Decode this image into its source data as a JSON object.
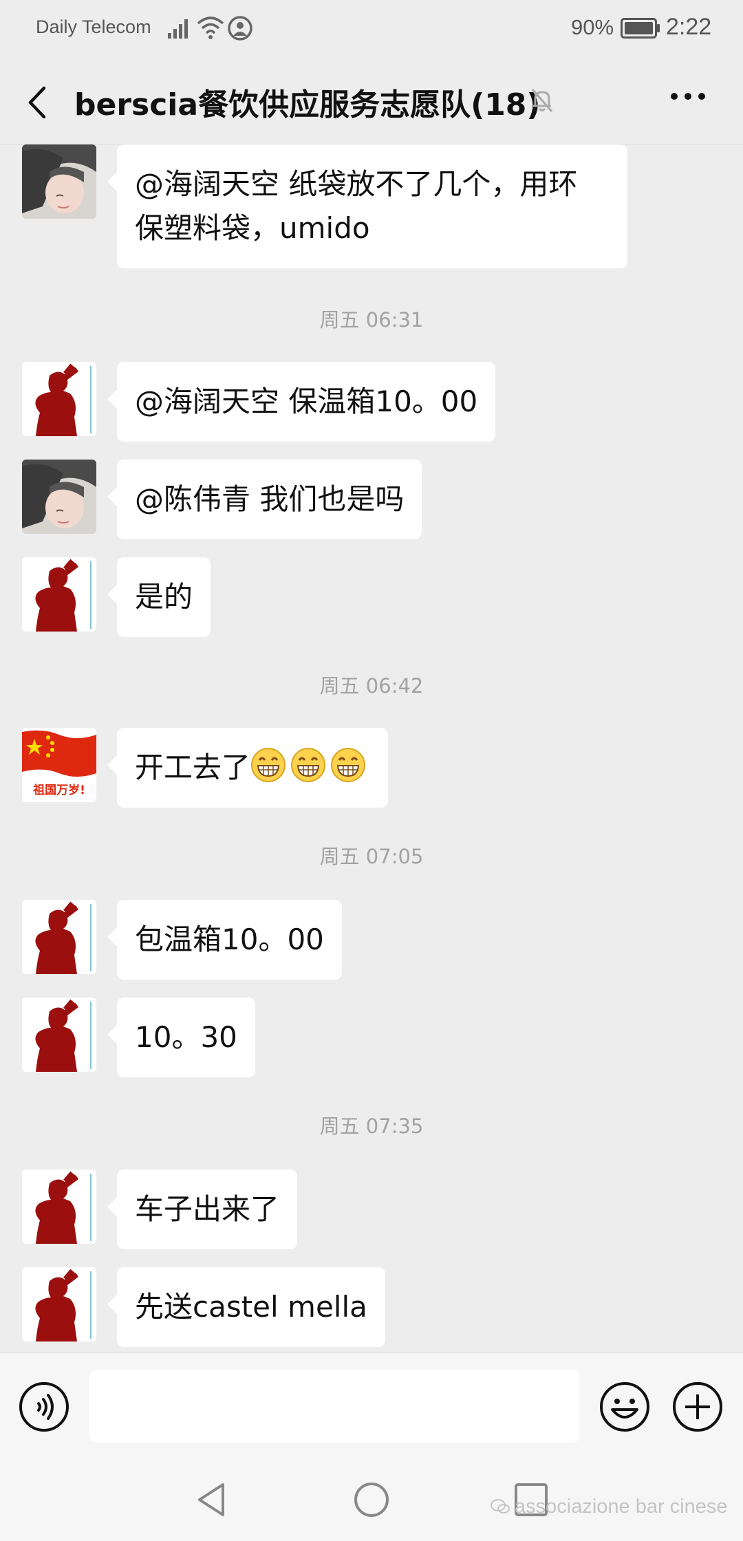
{
  "status_bar": {
    "carrier": "Daily Telecom",
    "battery": "90%",
    "time": "2:22"
  },
  "nav": {
    "title": "berscia餐饮供应服务志愿队(18)"
  },
  "messages": [
    {
      "type": "message",
      "avatar": "girl-photo",
      "lines": [
        "@海阔天空 纸袋放不了几个，用环",
        "保塑料袋，umido"
      ]
    },
    {
      "type": "timestamp",
      "text": "周五 06:31"
    },
    {
      "type": "message",
      "avatar": "silhouette",
      "text": "@海阔天空 保温箱10。00"
    },
    {
      "type": "message",
      "avatar": "girl-photo",
      "text": "@陈伟青 我们也是吗"
    },
    {
      "type": "message",
      "avatar": "silhouette",
      "text": "是的"
    },
    {
      "type": "timestamp",
      "text": "周五 06:42"
    },
    {
      "type": "message",
      "avatar": "flag",
      "avatar_text": "祖国万岁!",
      "text": "开工去了",
      "emoji_count": 3,
      "emoji": "grin-emoji"
    },
    {
      "type": "timestamp",
      "text": "周五 07:05"
    },
    {
      "type": "message",
      "avatar": "silhouette",
      "text": "包温箱10。00"
    },
    {
      "type": "message",
      "avatar": "silhouette",
      "text": "10。30"
    },
    {
      "type": "timestamp",
      "text": "周五 07:35"
    },
    {
      "type": "message",
      "avatar": "silhouette",
      "text": "车子出来了"
    },
    {
      "type": "message",
      "avatar": "silhouette",
      "text": "先送castel mella"
    }
  ],
  "input": {
    "value": "",
    "placeholder": ""
  },
  "watermark": {
    "text": "associazione bar cinese"
  },
  "colors": {
    "background": "#ededed",
    "bubble": "#ffffff",
    "timestamp": "#a2a2a2",
    "silhouette": "#9b0f0f",
    "flag": "#de2910"
  }
}
